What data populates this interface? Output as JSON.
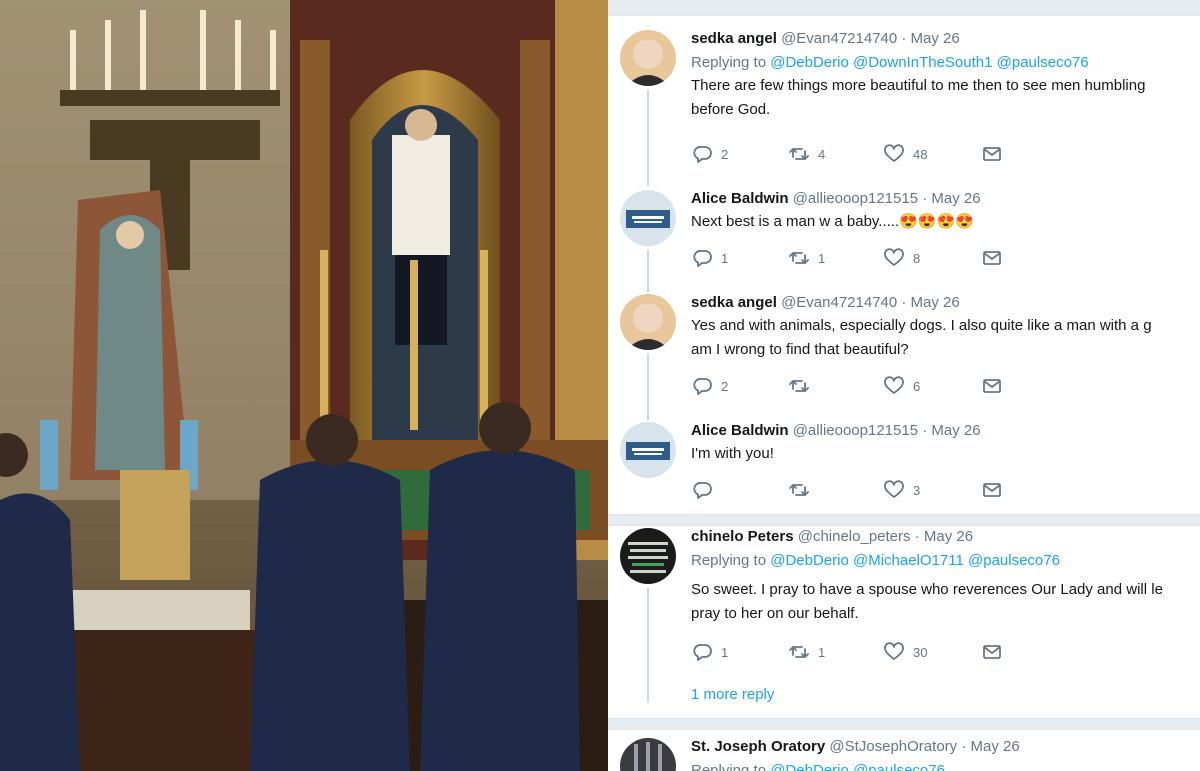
{
  "photo": {
    "description_icon": "church-altar-photo"
  },
  "tweets": [
    {
      "name": "sedka angel",
      "handle": "@Evan47214740",
      "date": "· May 26",
      "replying_prefix": "Replying to",
      "mentions": [
        "@DebDerio",
        "@DownInTheSouth1",
        "@paulseco76"
      ],
      "text_line1": "There are few things more beautiful to me then to see men humbling",
      "text_line2": "before God.",
      "replies": "2",
      "retweets": "4",
      "likes": "48"
    },
    {
      "name": "Alice Baldwin",
      "handle": "@allieooop121515",
      "date": "· May 26",
      "text_line1": "Next best is a man w a baby.....",
      "emoji": "😍😍😍😍",
      "replies": "1",
      "retweets": "1",
      "likes": "8"
    },
    {
      "name": "sedka angel",
      "handle": "@Evan47214740",
      "date": "· May 26",
      "text_line1": "Yes and with animals, especially dogs.  I also quite like a man with a g",
      "text_line2": "am I wrong to find that beautiful?",
      "replies": "2",
      "retweets": "",
      "likes": "6"
    },
    {
      "name": "Alice Baldwin",
      "handle": "@allieooop121515",
      "date": "· May 26",
      "text_line1": "I'm with you!",
      "replies": "",
      "retweets": "",
      "likes": "3"
    },
    {
      "name": "chinelo Peters",
      "handle": "@chinelo_peters",
      "date": "· May 26",
      "replying_prefix": "Replying to",
      "mentions": [
        "@DebDerio",
        "@MichaelO1711",
        "@paulseco76"
      ],
      "text_line1": "So sweet. I pray to have a spouse who reverences Our Lady and will le",
      "text_line2": "pray to her on our behalf.",
      "replies": "1",
      "retweets": "1",
      "likes": "30",
      "more_reply": "1 more reply"
    },
    {
      "name": "St. Joseph Oratory",
      "handle": "@StJosephOratory",
      "date": "· May 26",
      "replying_prefix": "Replying to",
      "mentions": [
        "@DebDerio",
        "@paulseco76"
      ]
    }
  ],
  "colors": {
    "accent": "#1da1f2",
    "text": "#14171a",
    "muted": "#657786",
    "divider": "#e6ecf0"
  }
}
